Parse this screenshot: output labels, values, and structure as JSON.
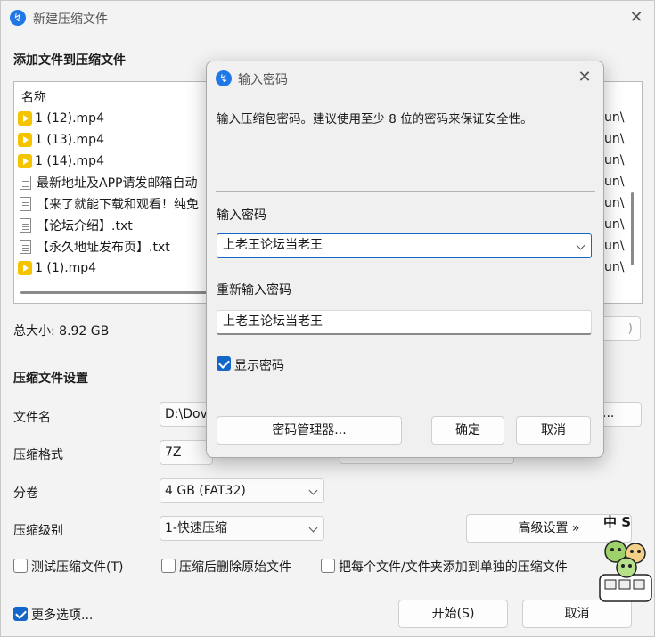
{
  "main_window": {
    "title": "新建压缩文件",
    "add_section_title": "添加文件到压缩文件",
    "list_header": "名称",
    "files": [
      {
        "name": "1 (12).mp4",
        "type": "video",
        "path_fragment": "un\\"
      },
      {
        "name": "1 (13).mp4",
        "type": "video",
        "path_fragment": "un\\"
      },
      {
        "name": "1 (14).mp4",
        "type": "video",
        "path_fragment": "un\\"
      },
      {
        "name": "最新地址及APP请发邮箱自动",
        "type": "doc",
        "path_fragment": "un\\"
      },
      {
        "name": "【来了就能下载和观看！纯免",
        "type": "doc",
        "path_fragment": "un\\"
      },
      {
        "name": "【论坛介绍】.txt",
        "type": "doc",
        "path_fragment": "un\\"
      },
      {
        "name": "【永久地址发布页】.txt",
        "type": "doc",
        "path_fragment": "un\\"
      },
      {
        "name": "1 (1).mp4",
        "type": "video",
        "path_fragment": "un\\"
      }
    ],
    "total_size": "总大小: 8.92 GB",
    "settings_title": "压缩文件设置",
    "filename_label": "文件名",
    "filename_value": "D:\\Dov",
    "browse_button_fragment": "...",
    "format_label": "压缩格式",
    "format_value": "7Z",
    "split_label": "分卷",
    "split_value": "4 GB (FAT32)",
    "level_label": "压缩级别",
    "level_value": "1-快速压缩",
    "advanced_button": "高级设置 »",
    "test_archive_label": "测试压缩文件(T)",
    "delete_after_label": "压缩后删除原始文件",
    "separate_archives_label": "把每个文件/文件夹添加到单独的压缩文件",
    "more_options_label": "更多选项...",
    "start_button": "开始(S)",
    "cancel_button": "取消",
    "partial_button_text": ")",
    "mascot_text": "中 S"
  },
  "password_dialog": {
    "title": "输入密码",
    "description": "输入压缩包密码。建议使用至少 8 位的密码来保证安全性。",
    "password_label": "输入密码",
    "password_value": "上老王论坛当老王",
    "confirm_label": "重新输入密码",
    "confirm_value": "上老王论坛当老王",
    "show_password_label": "显示密码",
    "show_password_checked": true,
    "manager_button": "密码管理器...",
    "ok_button": "确定",
    "cancel_button": "取消"
  },
  "colors": {
    "accent": "#1466c8",
    "app_icon": "#1f78e6",
    "video_icon": "#f5c400"
  }
}
